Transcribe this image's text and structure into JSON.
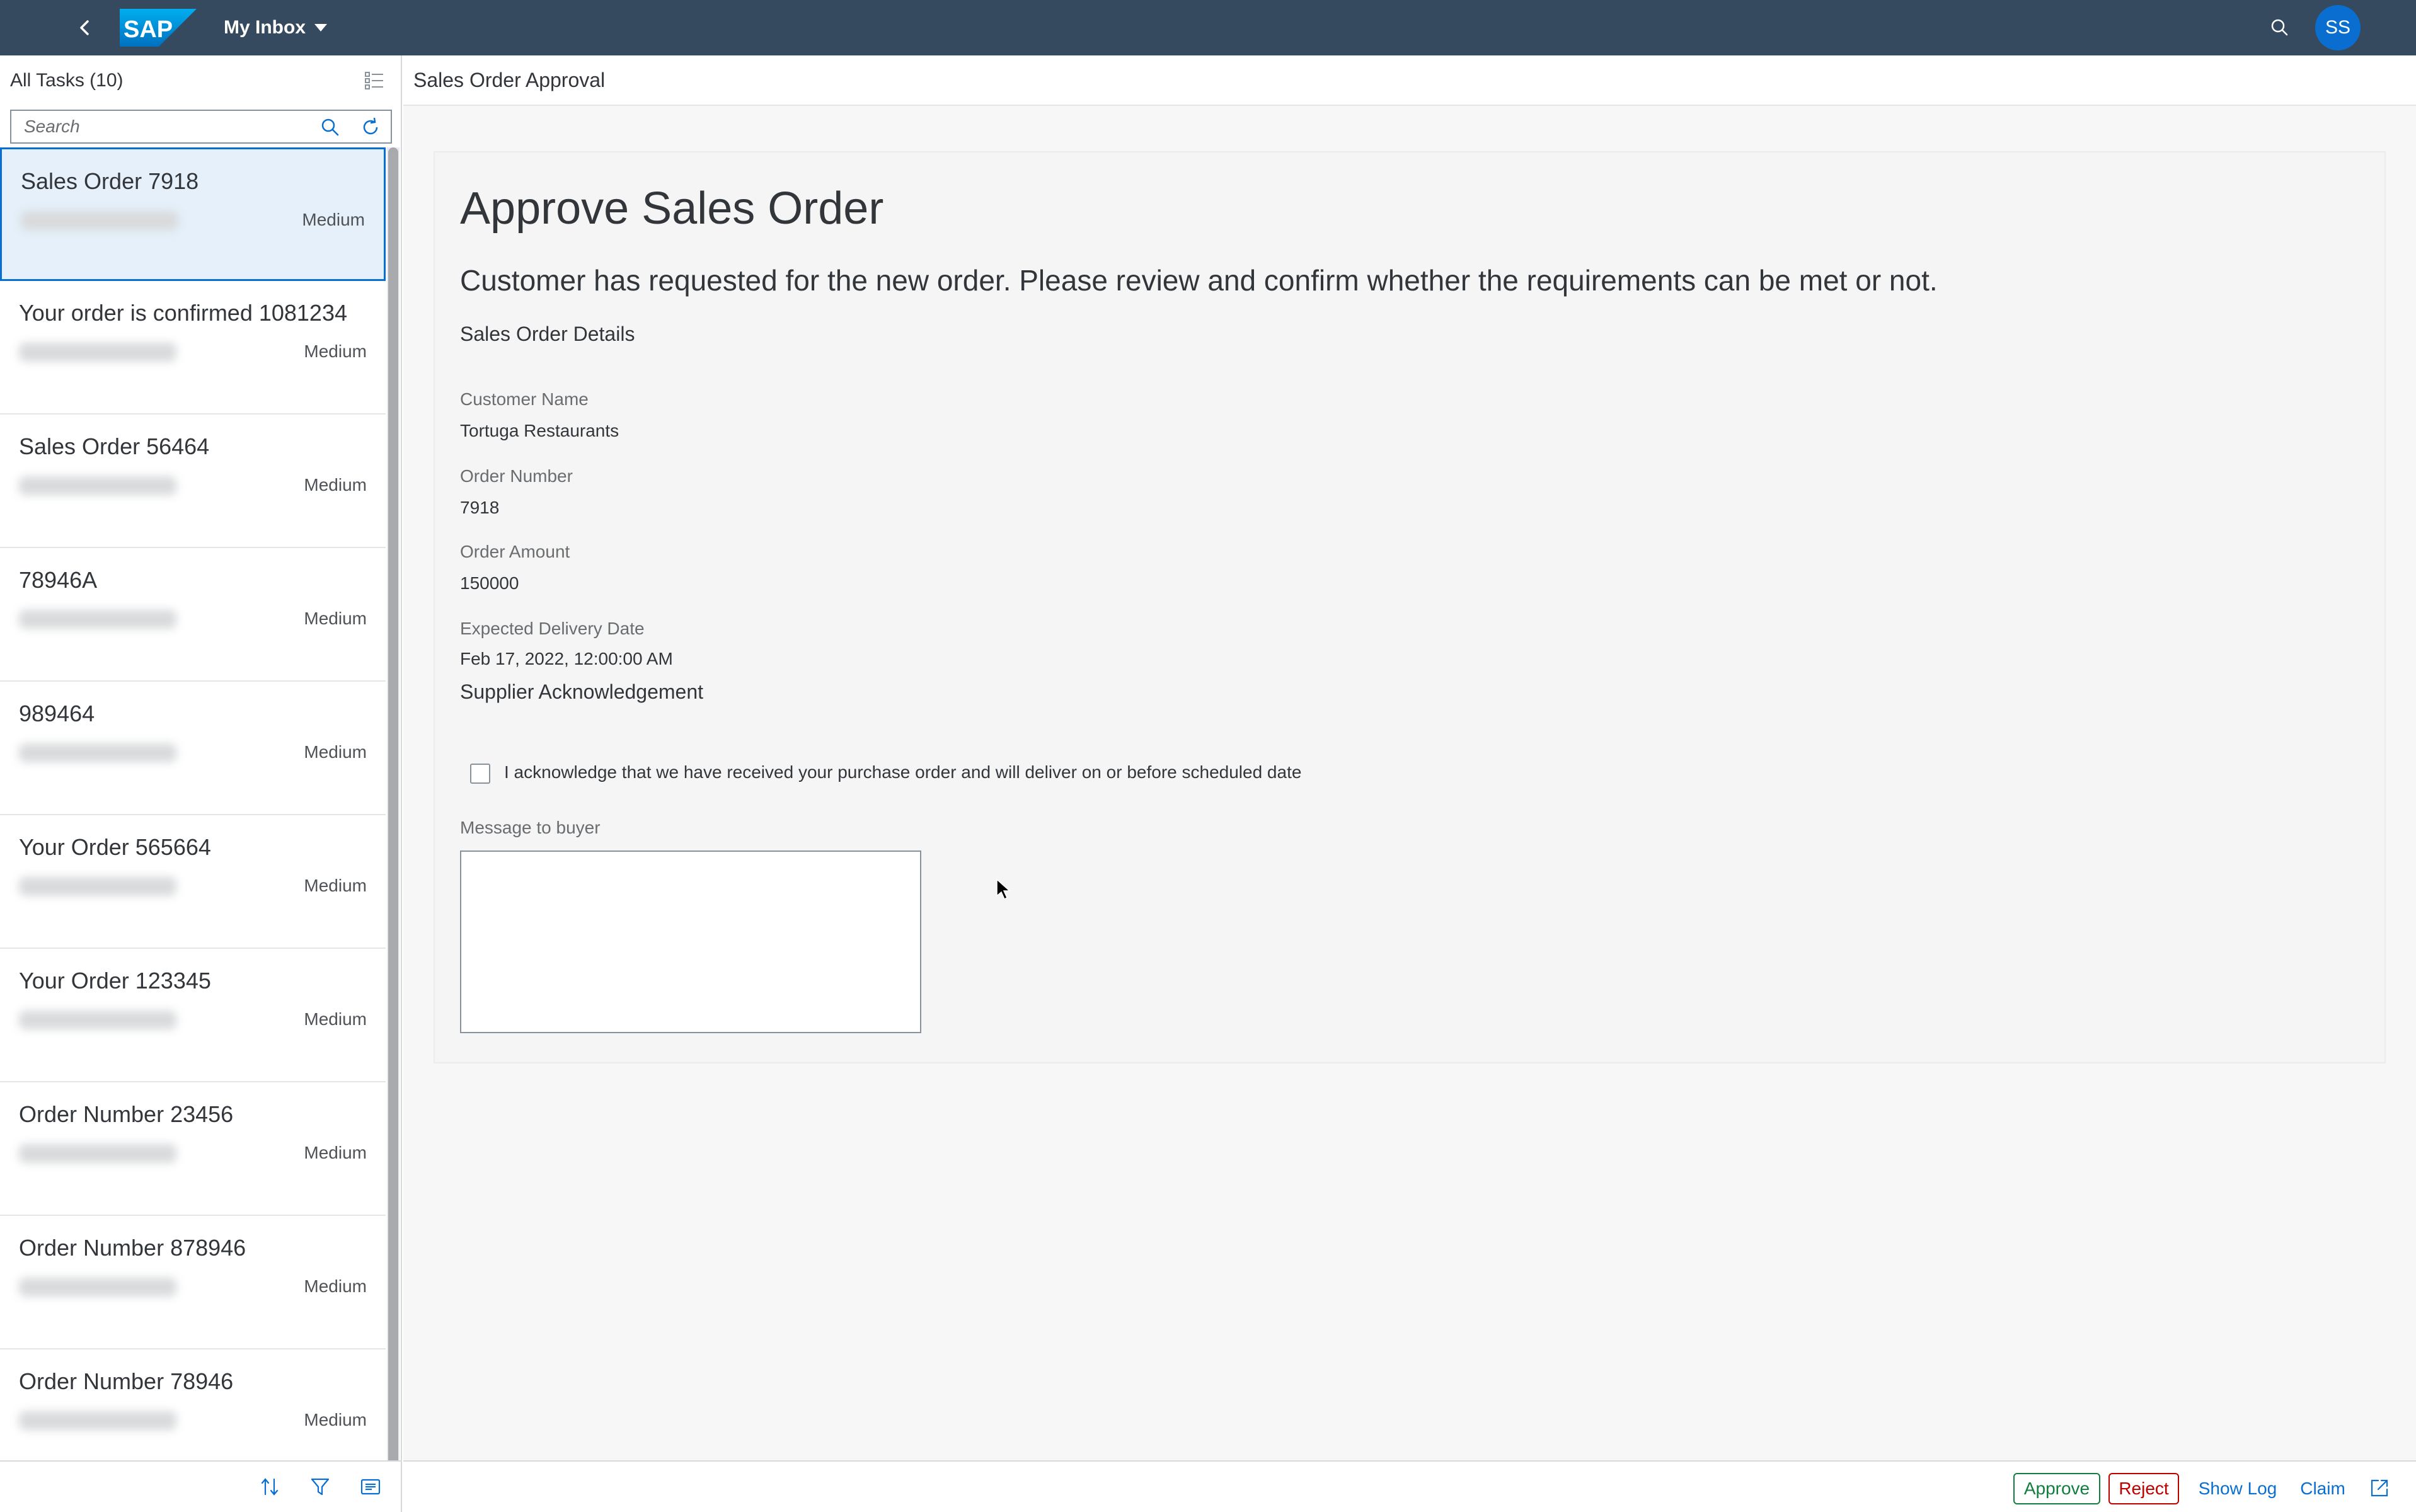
{
  "shell": {
    "title": "My Inbox",
    "avatar_initials": "SS",
    "logo_text": "SAP",
    "colors": {
      "shell_bg": "#354a5f",
      "avatar_bg": "#0a6ed1",
      "logo_blue": "#1e88e5"
    }
  },
  "master": {
    "header": "All Tasks (10)",
    "search_placeholder": "Search",
    "items": [
      {
        "name": "Sales Order 7918",
        "priority": "Medium",
        "selected": true
      },
      {
        "name": "Your order is confirmed 1081234",
        "priority": "Medium"
      },
      {
        "name": "Sales Order 56464",
        "priority": "Medium"
      },
      {
        "name": "78946A",
        "priority": "Medium"
      },
      {
        "name": "989464",
        "priority": "Medium"
      },
      {
        "name": "Your Order 565664",
        "priority": "Medium"
      },
      {
        "name": "Your Order 123345",
        "priority": "Medium"
      },
      {
        "name": "Order Number 23456",
        "priority": "Medium"
      },
      {
        "name": "Order Number 878946",
        "priority": "Medium"
      },
      {
        "name": "Order Number 78946",
        "priority": "Medium"
      }
    ]
  },
  "detail": {
    "header": "Sales Order Approval",
    "title": "Approve Sales Order",
    "description": "Customer has requested for the new order. Please review and confirm whether the requirements can be met or not.",
    "section_details": "Sales Order Details",
    "fields": [
      {
        "label": "Customer Name",
        "value": "Tortuga Restaurants"
      },
      {
        "label": "Order Number",
        "value": "7918"
      },
      {
        "label": "Order Amount",
        "value": "150000"
      },
      {
        "label": "Expected Delivery Date",
        "value": "Feb 17, 2022, 12:00:00 AM"
      }
    ],
    "section_ack": "Supplier Acknowledgement",
    "ack_text": "I acknowledge that we have received your purchase order and will deliver on or before scheduled date",
    "ack_checked": false,
    "message_label": "Message to buyer",
    "message_value": ""
  },
  "footer": {
    "approve": "Approve",
    "reject": "Reject",
    "show_log": "Show Log",
    "claim": "Claim",
    "colors": {
      "approve": "#107e3e",
      "reject": "#bb0000",
      "link": "#0a6ed1"
    }
  }
}
